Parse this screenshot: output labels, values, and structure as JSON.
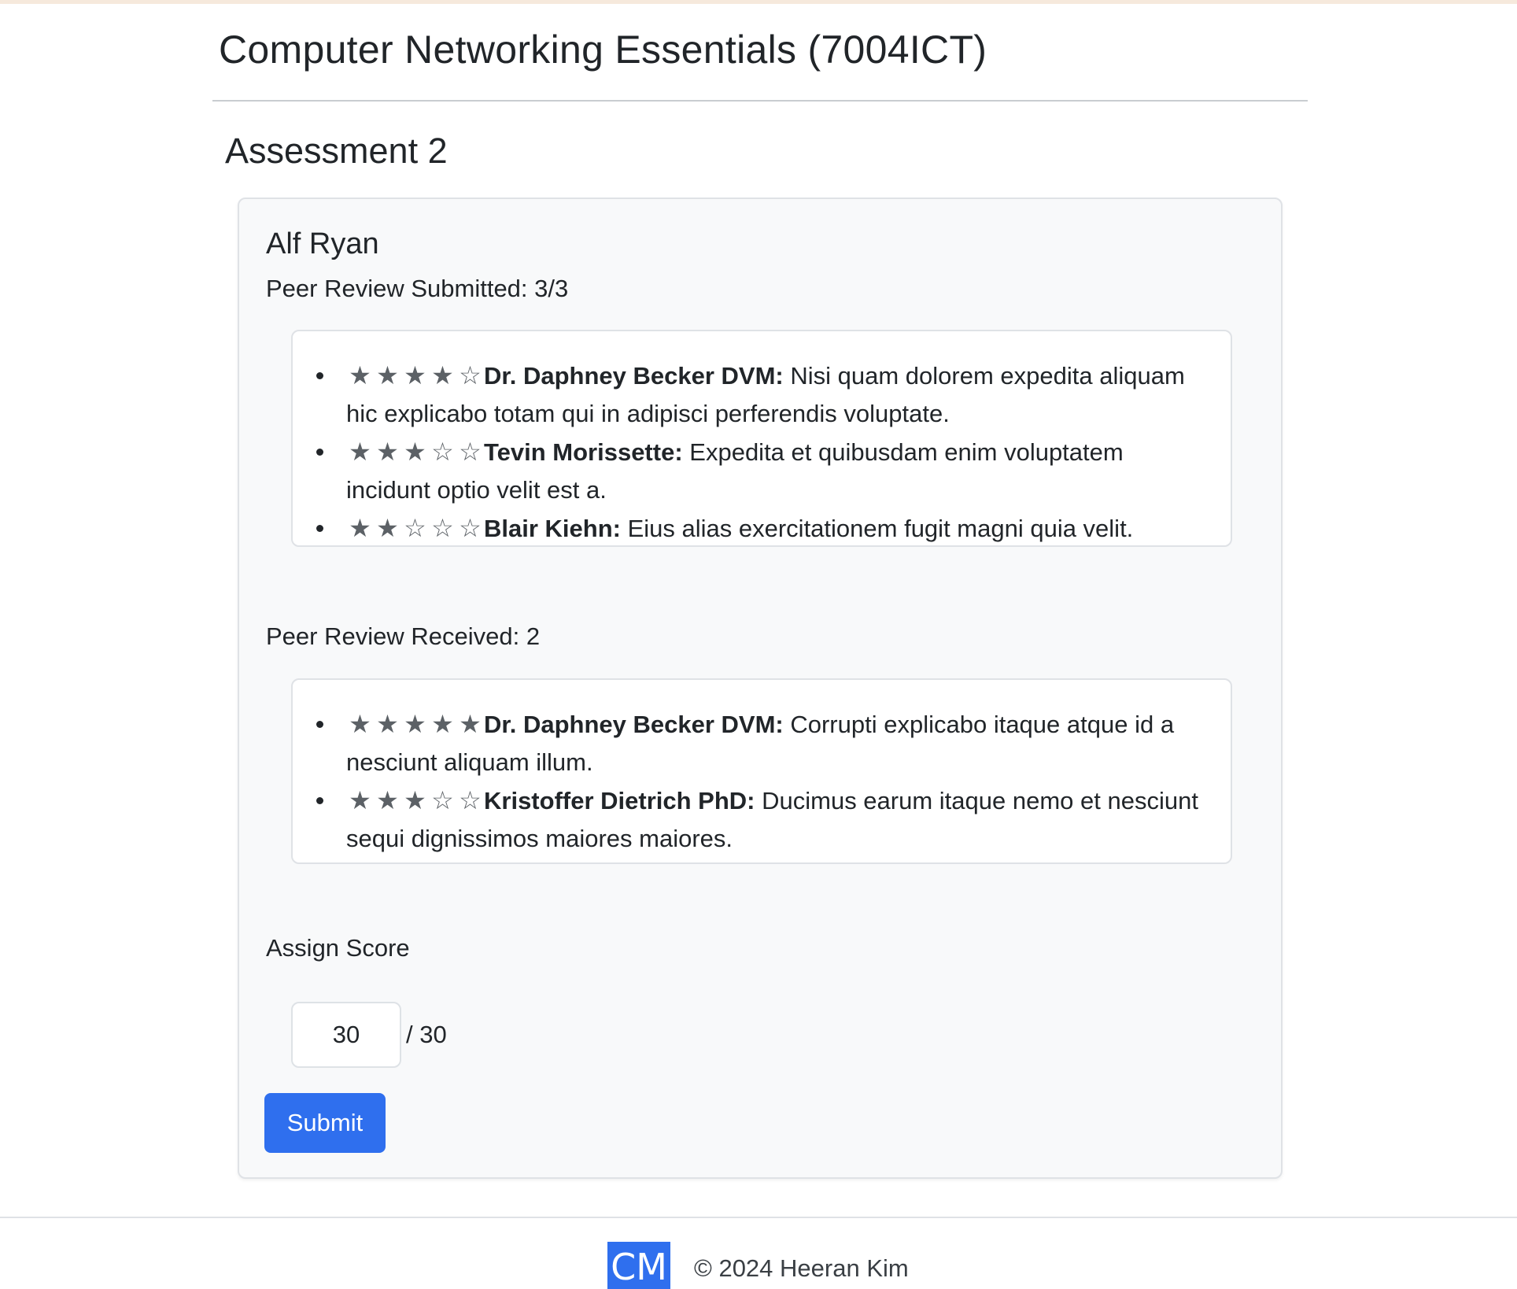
{
  "header": {
    "course_title": "Computer Networking Essentials (7004ICT)",
    "assessment_title": "Assessment 2"
  },
  "student": {
    "name": "Alf Ryan",
    "submitted_label": "Peer Review Submitted: 3/3",
    "received_label": "Peer Review Received: 2"
  },
  "reviews_submitted": [
    {
      "rating": 4,
      "reviewer": "Dr. Daphney Becker DVM:",
      "comment": "Nisi quam dolorem expedita aliquam hic explicabo totam qui in adipisci perferendis voluptate."
    },
    {
      "rating": 3,
      "reviewer": "Tevin Morissette:",
      "comment": "Expedita et quibusdam enim voluptatem incidunt optio velit est a."
    },
    {
      "rating": 2,
      "reviewer": "Blair Kiehn:",
      "comment": "Eius alias exercitationem fugit magni quia velit."
    }
  ],
  "reviews_received": [
    {
      "rating": 5,
      "reviewer": "Dr. Daphney Becker DVM:",
      "comment": "Corrupti explicabo itaque atque id a nesciunt aliquam illum."
    },
    {
      "rating": 3,
      "reviewer": "Kristoffer Dietrich PhD:",
      "comment": "Ducimus earum itaque nemo et nesciunt sequi dignissimos maiores maiores."
    }
  ],
  "score": {
    "label": "Assign Score",
    "value": "30",
    "max_label": "/ 30",
    "submit_label": "Submit"
  },
  "footer": {
    "logo_text": "CM",
    "copyright": "© 2024 Heeran Kim"
  },
  "colors": {
    "accent": "#2f6fee",
    "star": "#5c6166"
  },
  "icons": {
    "star_filled": "star-filled-icon",
    "star_empty": "star-empty-icon"
  }
}
